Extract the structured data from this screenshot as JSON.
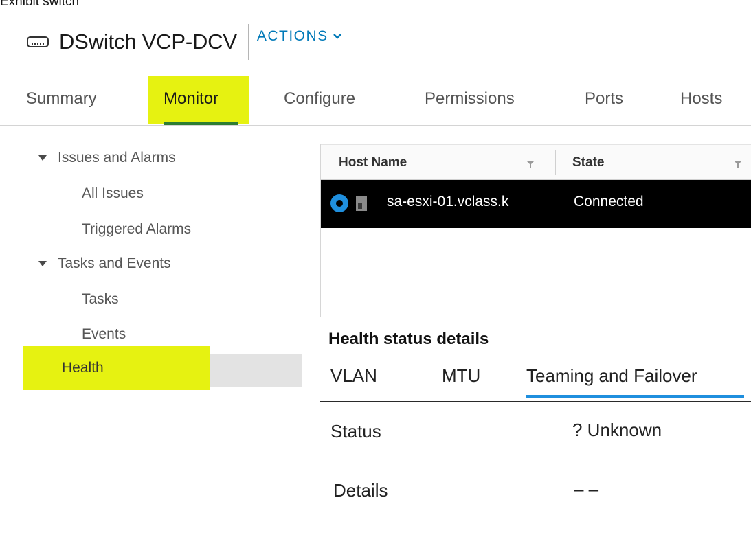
{
  "caption": "Exhibit switch",
  "header": {
    "title": "DSwitch VCP-DCV",
    "actions_label": "ACTIONS"
  },
  "tabs": [
    {
      "label": "Summary",
      "active": false
    },
    {
      "label": "Monitor",
      "active": true
    },
    {
      "label": "Configure",
      "active": false
    },
    {
      "label": "Permissions",
      "active": false
    },
    {
      "label": "Ports",
      "active": false
    },
    {
      "label": "Hosts",
      "active": false
    }
  ],
  "nav": {
    "issues_group": {
      "label": "Issues and Alarms",
      "items": [
        "All Issues",
        "Triggered Alarms"
      ]
    },
    "tasks_group": {
      "label": "Tasks and Events",
      "items": [
        "Tasks",
        "Events"
      ]
    },
    "health": "Health"
  },
  "grid": {
    "columns": [
      "Host Name",
      "State"
    ],
    "rows": [
      {
        "host": "sa-esxi-01.vclass.k",
        "state": "Connected",
        "selected": true
      }
    ]
  },
  "health_details": {
    "title": "Health status details",
    "tabs": [
      "VLAN",
      "MTU",
      "Teaming and Failover"
    ],
    "active_tab": "Teaming and Failover",
    "status_label": "Status",
    "status_value": "? Unknown",
    "details_label": "Details",
    "details_value": "– –"
  },
  "colors": {
    "highlight": "#e6f211",
    "active_tab_underline": "#2e7d32",
    "link_blue": "#0079b8",
    "select_blue": "#1f8fde"
  }
}
